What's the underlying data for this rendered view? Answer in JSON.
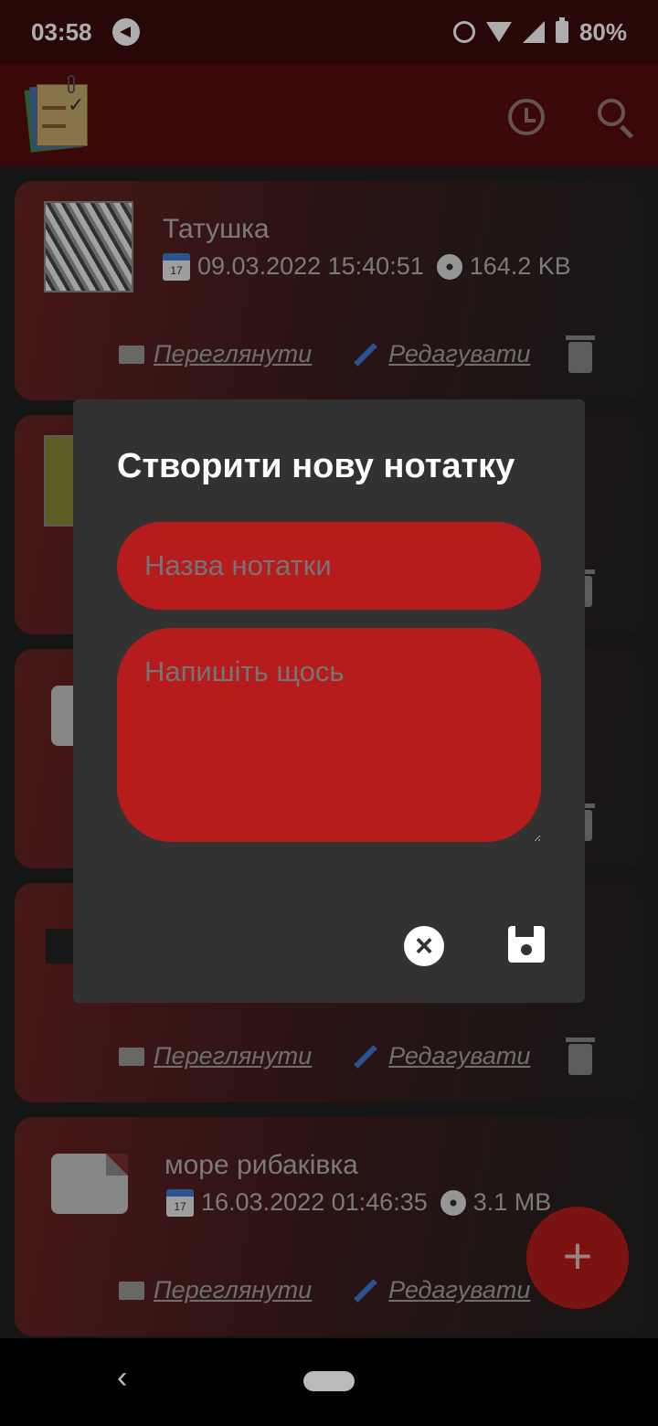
{
  "status_bar": {
    "time": "03:58",
    "battery": "80%"
  },
  "app": {
    "logo": "notes-logo"
  },
  "notes": [
    {
      "title": "Татушка",
      "date": "09.03.2022 15:40:51",
      "size": "164.2 KB",
      "thumb": "photo"
    },
    {
      "title": "",
      "date": "",
      "size": "",
      "thumb": "image"
    },
    {
      "title": "",
      "date": "",
      "size": "",
      "thumb": "file"
    },
    {
      "title": "",
      "date": "",
      "size": "",
      "thumb": "avatar"
    },
    {
      "title": "море рибаківка",
      "date": "16.03.2022 01:46:35",
      "size": "3.1 MB",
      "thumb": "file"
    }
  ],
  "actions": {
    "view": "Переглянути",
    "edit": "Редагувати"
  },
  "calendar": {
    "month": "July",
    "day": "17"
  },
  "fab_label": "+",
  "dialog": {
    "title": "Створити нову нотатку",
    "name_placeholder": "Назва нотатки",
    "body_placeholder": "Напишіть щось",
    "cancel_icon": "×"
  },
  "colors": {
    "accent": "#b71c1c",
    "appbar": "#560c0e",
    "dialog": "#323232"
  },
  "nav": {
    "back": "‹"
  }
}
